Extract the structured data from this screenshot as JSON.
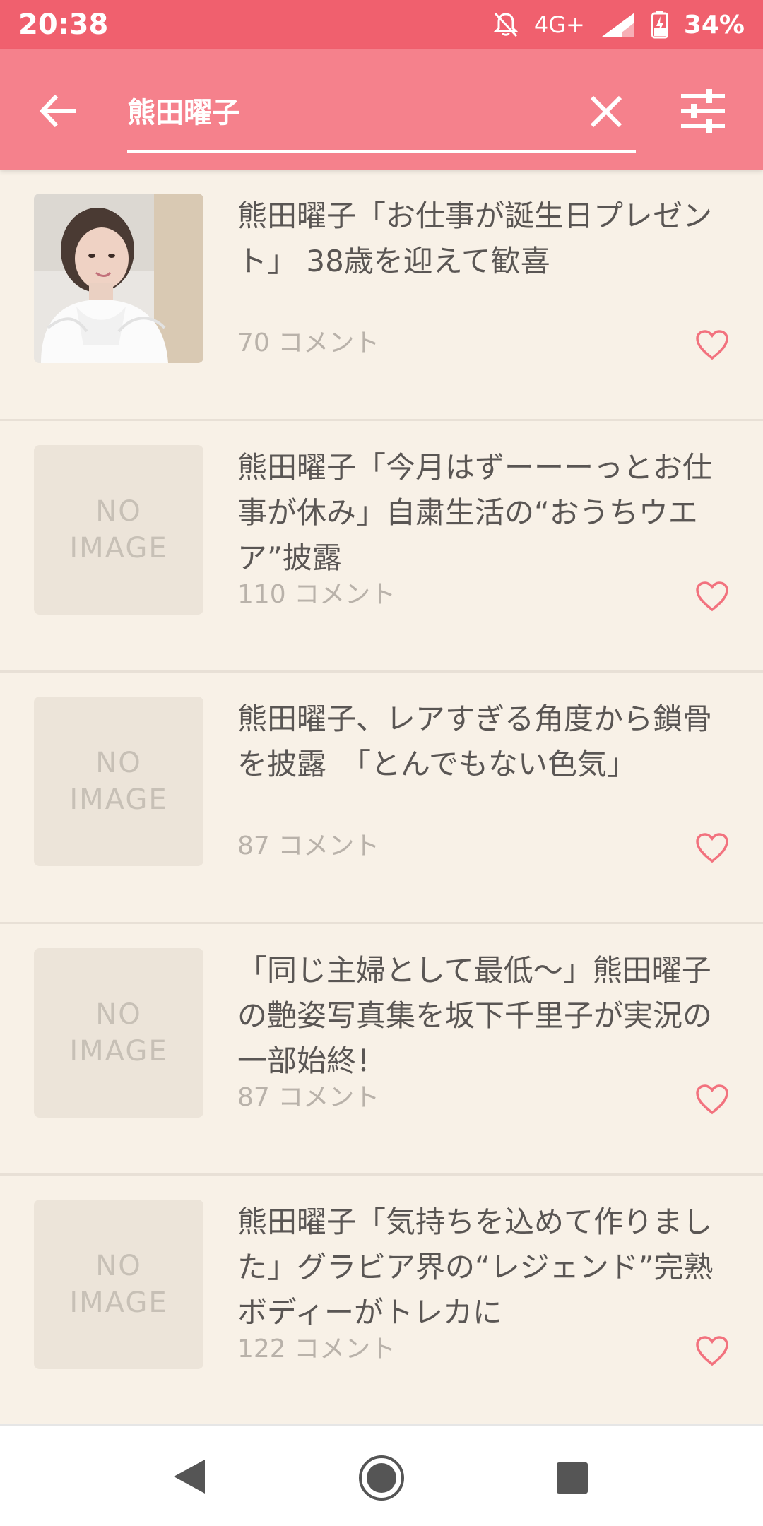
{
  "status_bar": {
    "time": "20:38",
    "network": "4G+",
    "battery": "34%",
    "icons": [
      "mute-bell-icon",
      "signal-icon",
      "battery-charging-icon"
    ]
  },
  "toolbar": {
    "back_icon": "arrow-left-icon",
    "search_value": "熊田曜子",
    "clear_icon": "close-icon",
    "filter_icon": "sliders-icon"
  },
  "colors": {
    "status_bar": "#f0606e",
    "toolbar": "#f5818c",
    "background": "#f8f1e7",
    "heart": "#f2727e"
  },
  "no_image_text": [
    "NO",
    "IMAGE"
  ],
  "articles": [
    {
      "title": "熊田曜子「お仕事が誕生日プレゼント」 38歳を迎えて歓喜",
      "comments": "70 コメント",
      "has_image": true
    },
    {
      "title": "熊田曜子「今月はずーーーっとお仕事が休み」自粛生活の“おうちウエア”披露",
      "comments": "110 コメント",
      "has_image": false
    },
    {
      "title": "熊田曜子、レアすぎる角度から鎖骨を披露　「とんでもない色気」",
      "comments": "87 コメント",
      "has_image": false
    },
    {
      "title": "「同じ主婦として最低～」熊田曜子の艶姿写真集を坂下千里子が実況の一部始終！",
      "comments": "87 コメント",
      "has_image": false
    },
    {
      "title": "熊田曜子「気持ちを込めて作りました」グラビア界の“レジェンド”完熟ボディーがトレカに",
      "comments": "122 コメント",
      "has_image": false
    }
  ],
  "nav": {
    "back_icon": "nav-back-icon",
    "home_icon": "nav-home-icon",
    "recent_icon": "nav-recent-icon"
  }
}
